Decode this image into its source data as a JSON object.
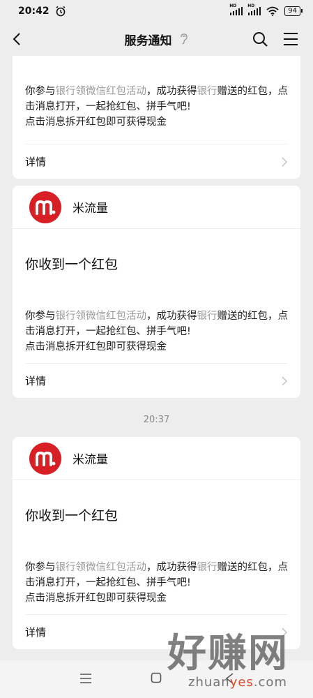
{
  "status_bar": {
    "time": "20:42",
    "network_1": "HD",
    "network_2": "HD",
    "battery": "94"
  },
  "nav": {
    "title": "服务通知"
  },
  "cards": [
    {
      "brand": "",
      "title": "",
      "body_prefix": "你参与",
      "body_link_1": "银行领微信红包活动",
      "body_middle": "，成功获得",
      "body_link_2": "银行",
      "body_suffix": "赠送的红包，点击消息打开，一起抢红包、拼手气吧!",
      "body_line_2": "点击消息拆开红包即可获得现金",
      "detail_label": "详情"
    },
    {
      "brand": "米流量",
      "title": "你收到一个红包",
      "body_prefix": "你参与",
      "body_link_1": "银行领微信红包活动",
      "body_middle": "，成功获得",
      "body_link_2": "银行",
      "body_suffix": "赠送的红包，点击消息打开，一起抢红包、拼手气吧!",
      "body_line_2": "点击消息拆开红包即可获得现金",
      "detail_label": "详情"
    },
    {
      "brand": "米流量",
      "title": "你收到一个红包",
      "body_prefix": "你参与",
      "body_link_1": "银行领微信红包活动",
      "body_middle": "，成功获得",
      "body_link_2": "银行",
      "body_suffix": "赠送的红包，点击消息打开，一起抢红包、拼手气吧!",
      "body_line_2": "点击消息拆开红包即可获得现金",
      "detail_label": "详情"
    }
  ],
  "timestamp": "20:37",
  "watermark": {
    "big": "好赚网",
    "url_a": "zhuan",
    "url_b": "yes",
    "url_c": ".com"
  },
  "colors": {
    "background": "#ededed",
    "card": "#ffffff",
    "brand_red": "#d81f26",
    "muted_link": "#9a9a9a"
  }
}
